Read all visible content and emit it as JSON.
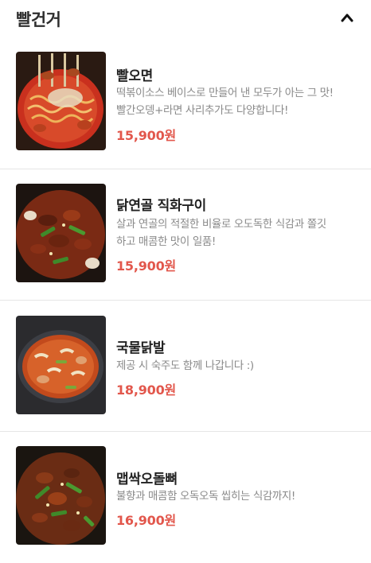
{
  "section": {
    "title": "빨건거",
    "collapse_icon": "chevron-up-icon"
  },
  "menu": [
    {
      "name": "빨오면",
      "desc_line1": "떡볶이소스 베이스로 만들어 낸 모두가 아는 그 맛!",
      "desc_line2": "빨간오뎅+라면 사리추가도 다양합니다!",
      "price": "15,900원"
    },
    {
      "name": "닭연골 직화구이",
      "desc_line1": "살과 연골의 적절한 비율로 오도독한 식감과 쫄깃",
      "desc_line2": "하고 매콤한 맛이 일품!",
      "price": "15,900원"
    },
    {
      "name": "국물닭발",
      "desc_line1": "제공 시 숙주도 함께 나갑니다 :)",
      "desc_line2": "",
      "price": "18,900원"
    },
    {
      "name": "맵싹오돌뼈",
      "desc_line1": "불향과 매콤함 오독오독 씹히는 식감까지!",
      "desc_line2": "",
      "price": "16,900원"
    }
  ],
  "colors": {
    "price": "#e2574c",
    "name": "#222222",
    "desc": "#8a8a8a",
    "divider": "#e6e6e6"
  }
}
